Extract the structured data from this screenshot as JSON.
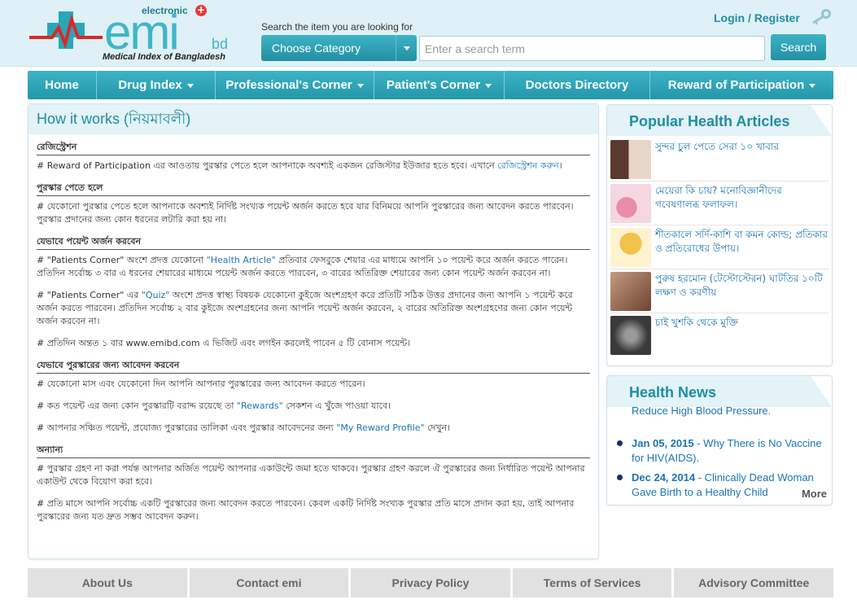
{
  "header": {
    "logo": {
      "electronic": "electronic",
      "plus": "+",
      "emi": "emi",
      "bd": "bd",
      "tagline": "Medical Index of Bangladesh"
    },
    "search_hint": "Search the item you are looking for",
    "category_label": "Choose Category",
    "search_placeholder": "Enter a search term",
    "search_button": "Search",
    "login_label": "Login / Register",
    "icons": [
      "key-icon",
      "chevron-down-icon"
    ]
  },
  "nav": {
    "items": [
      {
        "label": "Home",
        "dropdown": false
      },
      {
        "label": "Drug Index",
        "dropdown": true
      },
      {
        "label": "Professional's Corner",
        "dropdown": true
      },
      {
        "label": "Patient's Corner",
        "dropdown": true
      },
      {
        "label": "Doctors Directory",
        "dropdown": false
      },
      {
        "label": "Reward of Participation",
        "dropdown": true
      }
    ]
  },
  "main": {
    "title": "How it works (নিয়মাবলী)",
    "s1": {
      "heading": "রেজিস্ট্রেশন",
      "p1a": "# Reward of Participation এর আওতায় পুরস্কার পেতে হলে আপনাকে অবশ্যই একজন রেজিস্টার ইউজার হতে হবে। এখানে ",
      "p1link": "রেজিস্ট্রেশন করুন",
      "p1b": "।"
    },
    "s2": {
      "heading": "পুরস্কার পেতে হলে",
      "p1": "# যেকোনো পুরস্কার পেতে হলে আপনাকে অবশ্যই নির্দিষ্ট সংখ্যক পয়েন্ট অর্জন করতে হবে যার বিনিময়ে আপনি পুরস্কারের জন্য আবেদন করতে পারবেন। পুরস্কার প্রদানের জন্য কোন ধরনের লটারি করা হয় না।"
    },
    "s3": {
      "heading": "যেভাবে পয়েন্ট অর্জন করবেন",
      "p1a": "# \"Patients Corner\" অংশে প্রদত্ত যেকোনো ",
      "p1link": "\"Health Article\"",
      "p1b": " প্রতিবার ফেসবুকে শেয়ার এর মাধ্যমে আপনি ১০ পয়েন্ট করে অর্জন করতে পারেন। প্রতিদিন সর্বোচ্চ ৩ বার এ ধরনের শেয়ারের মাধ্যমে পয়েন্ট অর্জন করতে পারবেন, ৩ বারের অতিরিক্ত শেয়ারের জন্য কোন পয়েন্ট অর্জন করবেন না।",
      "p2a": "# \"Patients Corner\" এর ",
      "p2link": "\"Quiz\"",
      "p2b": " অংশে প্রদত্ত স্বাস্থ্য বিষয়ক যেকোনো কুইজে অংশগ্রহণ করে প্রতিটি সঠিক উত্তর প্রদানের জন্য আপনি ১ পয়েন্ট করে অর্জন করতে পারবেন। প্রতিদিন সর্বোচ্চ ২ বার কুইজে অংশগ্রহনের জন্য আপনি পয়েন্ট অর্জন করবেন, ২ বারের অতিরিক্ত অংশগ্রহণের জন্য কোন পয়েন্ট অর্জন করবেন না।",
      "p3": "# প্রতিদিন অন্তত ১ বার www.emibd.com এ ভিজিট এবং লগইন করলেই পাবেন ৫ টি বোনাস পয়েন্ট।"
    },
    "s4": {
      "heading": "যেভাবে পুরস্কারের জন্য আবেদন করবেন",
      "p1": "# যেকোনো মাস এবং যেকোনো দিন আপনি আপনার পুরস্কারের জন্য আবেদন করতে পারেন।",
      "p2a": "# কত পয়েন্ট এর জন্য কোন পুরস্কারটি বরাদ্দ রয়েছে তা ",
      "p2link": "\"Rewards\"",
      "p2b": " সেকশন এ খুঁজে পাওয়া যাবে।",
      "p3a": "# আপনার সঞ্চিত পয়েন্ট, প্রযোজ্য পুরস্কারের তালিকা এবং পুরস্কার আবেদনের জন্য ",
      "p3link": "\"My Reward Profile\"",
      "p3b": " দেখুন।"
    },
    "s5": {
      "heading": "অন্যান্য",
      "p1": "# পুরস্কার গ্রহণ না করা পর্যন্ত আপনার অর্জিত পয়েন্ট আপনার একাউন্টে জমা হতে থাকবে। পুরস্কার গ্রহণ করলে ঐ পুরস্কারের জন্য নির্ধারিত পয়েন্ট আপনার একাউন্ট থেকে বিয়োগ করা হবে।",
      "p2": "# প্রতি মাসে আপনি সর্বোচ্চ একটি পুরস্কারের জন্য আবেদন করতে পারবেন। কেবল একটি নির্দিষ্ট সংখ্যক পুরস্কার প্রতি মাসে প্রদান করা হয়, তাই আপনার পুরস্কারের জন্য যত দ্রুত সম্ভব আবেদন করুন।"
    }
  },
  "popular": {
    "title": "Popular Health Articles",
    "articles": [
      {
        "title": "সুন্দর চুল পেতে সেরা ১০ খাবার",
        "thumb_color": "#6b4a3a"
      },
      {
        "title": "মেয়েরা কি চায়? মনোবিজ্ঞানীদের গবেষণালব্ধ ফলাফল।",
        "thumb_color": "#e98ca7"
      },
      {
        "title": "শীতকালে সর্দি-কাশি বা কমন কোল্ড; প্রতিকার ও প্রতিরোধের উপায়।",
        "thumb_color": "#f2c34a"
      },
      {
        "title": "পুরুষ হরমোন (টেস্টোস্টেরন) ঘাটতির ১০টি লক্ষণ ও করণীয়",
        "thumb_color": "#8a5a44"
      },
      {
        "title": "চাই খুশকি থেকে মুক্তি",
        "thumb_color": "#4a4a4a"
      }
    ]
  },
  "news": {
    "title": "Health News",
    "partial": "Reduce High Blood Pressure.",
    "items": [
      {
        "date": "Jan 05, 2015",
        "text": " - Why There is No Vaccine for HIV(AIDS)."
      },
      {
        "date": "Dec 24, 2014",
        "text": " - Clinically Dead Woman Gave Birth to a Healthy Child"
      }
    ],
    "more_label": "More"
  },
  "footer": {
    "links": [
      "About Us",
      "Contact emi",
      "Privacy Policy",
      "Terms of Services",
      "Advisory Committee"
    ]
  }
}
